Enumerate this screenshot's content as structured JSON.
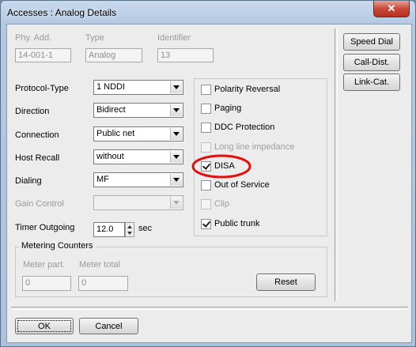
{
  "window": {
    "title": "Accesses : Analog Details",
    "close_glyph": "✕"
  },
  "header": {
    "phy_add_label": "Phy. Add.",
    "phy_add_value": "14-001-1",
    "type_label": "Type",
    "type_value": "Analog",
    "identifier_label": "Identifier",
    "identifier_value": "13"
  },
  "settings": [
    {
      "label": "Protocol-Type",
      "value": "1 NDDI",
      "enabled": true
    },
    {
      "label": "Direction",
      "value": "Bidirect",
      "enabled": true
    },
    {
      "label": "Connection",
      "value": "Public net",
      "enabled": true
    },
    {
      "label": "Host Recall",
      "value": "without",
      "enabled": true
    },
    {
      "label": "Dialing",
      "value": "MF",
      "enabled": true
    },
    {
      "label": "Gain Control",
      "value": "",
      "enabled": false
    }
  ],
  "timer": {
    "label": "Timer Outgoing",
    "value": "12.0",
    "unit": "sec"
  },
  "options": [
    {
      "label": "Polarity Reversal",
      "checked": false,
      "enabled": true
    },
    {
      "label": "Paging",
      "checked": false,
      "enabled": true
    },
    {
      "label": "DDC Protection",
      "checked": false,
      "enabled": true
    },
    {
      "label": "Long line impedance",
      "checked": false,
      "enabled": false
    },
    {
      "label": "DISA",
      "checked": true,
      "enabled": true,
      "highlighted": true
    },
    {
      "label": "Out of Service",
      "checked": false,
      "enabled": true
    },
    {
      "label": "Clip",
      "checked": false,
      "enabled": false
    },
    {
      "label": "Public trunk",
      "checked": true,
      "enabled": true
    }
  ],
  "metering": {
    "title": "Metering Counters",
    "meter_part_label": "Meter part.",
    "meter_part_value": "0",
    "meter_total_label": "Meter total",
    "meter_total_value": "0",
    "reset_label": "Reset"
  },
  "side_buttons": {
    "speed_dial": "Speed Dial",
    "call_dist": "Call-Dist.",
    "link_cat": "Link-Cat."
  },
  "footer": {
    "ok_label": "OK",
    "cancel_label": "Cancel"
  },
  "highlight_color": "#e01010"
}
